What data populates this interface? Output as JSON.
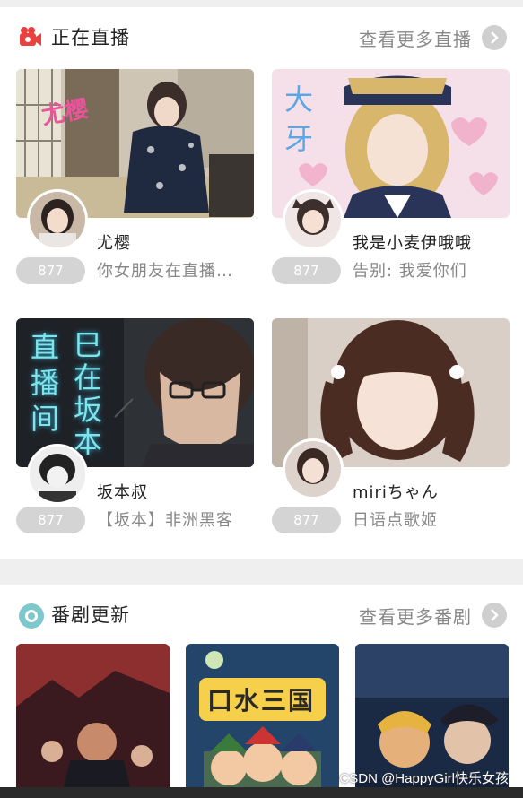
{
  "live": {
    "title": "正在直播",
    "more": "查看更多直播",
    "cards": [
      {
        "thumb_text": "尤樱",
        "name": "尤樱",
        "count": "877",
        "desc": "你女朋友在直播…"
      },
      {
        "thumb_text": "大牙",
        "name": "我是小麦伊哦哦",
        "count": "877",
        "desc": "告别: 我爱你们"
      },
      {
        "thumb_text_left": "直播间",
        "thumb_text_right": "巳在坂本",
        "name": "坂本叔",
        "count": "877",
        "desc": "【坂本】非洲黑客"
      },
      {
        "name": "miriちゃん",
        "count": "877",
        "desc": "日语点歌姬"
      }
    ]
  },
  "bangumi": {
    "title": "番剧更新",
    "more": "查看更多番剧",
    "items": [
      {
        "thumb_text": ""
      },
      {
        "thumb_text": "口水三国"
      },
      {
        "thumb_text": ""
      }
    ]
  },
  "watermark": "CSDN @HappyGirl快乐女孩",
  "colors": {
    "live_icon": "#e8413f",
    "bangumi_icon": "#7cc8cc",
    "count_bg": "#d4d4d4"
  },
  "icons": {
    "live": "video-camera-icon",
    "bangumi": "circle-dot-icon",
    "more": "chevron-right-icon"
  }
}
